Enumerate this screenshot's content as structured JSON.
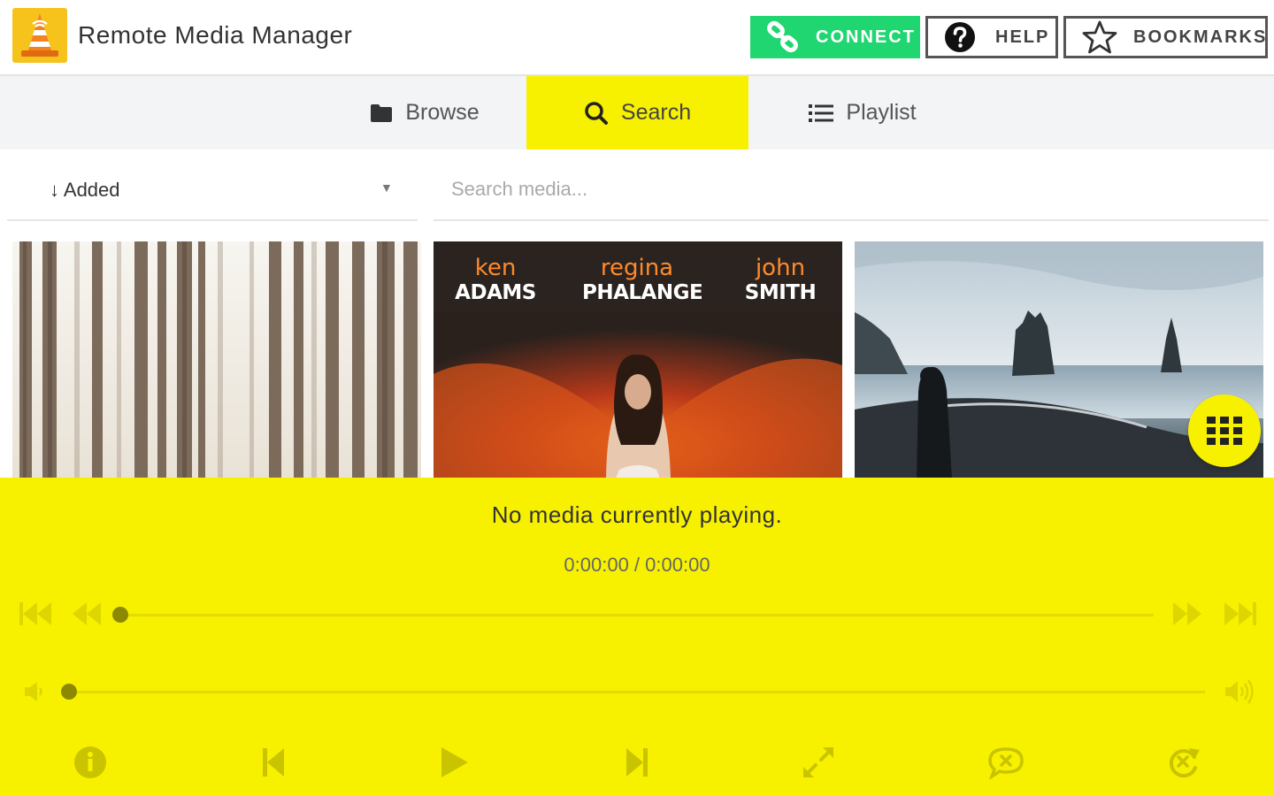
{
  "app": {
    "title": "Remote Media Manager"
  },
  "header": {
    "connect_label": "CONNECT",
    "help_label": "HELP",
    "bookmarks_label": "BOOKMARKS"
  },
  "nav": {
    "tabs": [
      {
        "label": "Browse",
        "icon": "folder-icon",
        "active": false
      },
      {
        "label": "Search",
        "icon": "search-icon",
        "active": true
      },
      {
        "label": "Playlist",
        "icon": "list-icon",
        "active": false
      }
    ]
  },
  "filters": {
    "sort_value": "↓ Added",
    "search_placeholder": "Search media...",
    "search_value": ""
  },
  "media": [
    {
      "icon": "forest-thumbnail"
    },
    {
      "icon": "movie-poster-thumbnail",
      "credits": [
        {
          "first": "ken",
          "last": "ADAMS"
        },
        {
          "first": "regina",
          "last": "PHALANGE"
        },
        {
          "first": "john",
          "last": "SMITH"
        }
      ]
    },
    {
      "icon": "sea-stacks-thumbnail"
    }
  ],
  "player": {
    "status_text": "No media currently playing.",
    "time_text": "0:00:00 / 0:00:00",
    "progress": 0,
    "volume": 0
  },
  "colors": {
    "accent_yellow": "#f7f100",
    "connect_green": "#1fd671",
    "control_icon": "#c9c300",
    "text_dark": "#333333"
  }
}
